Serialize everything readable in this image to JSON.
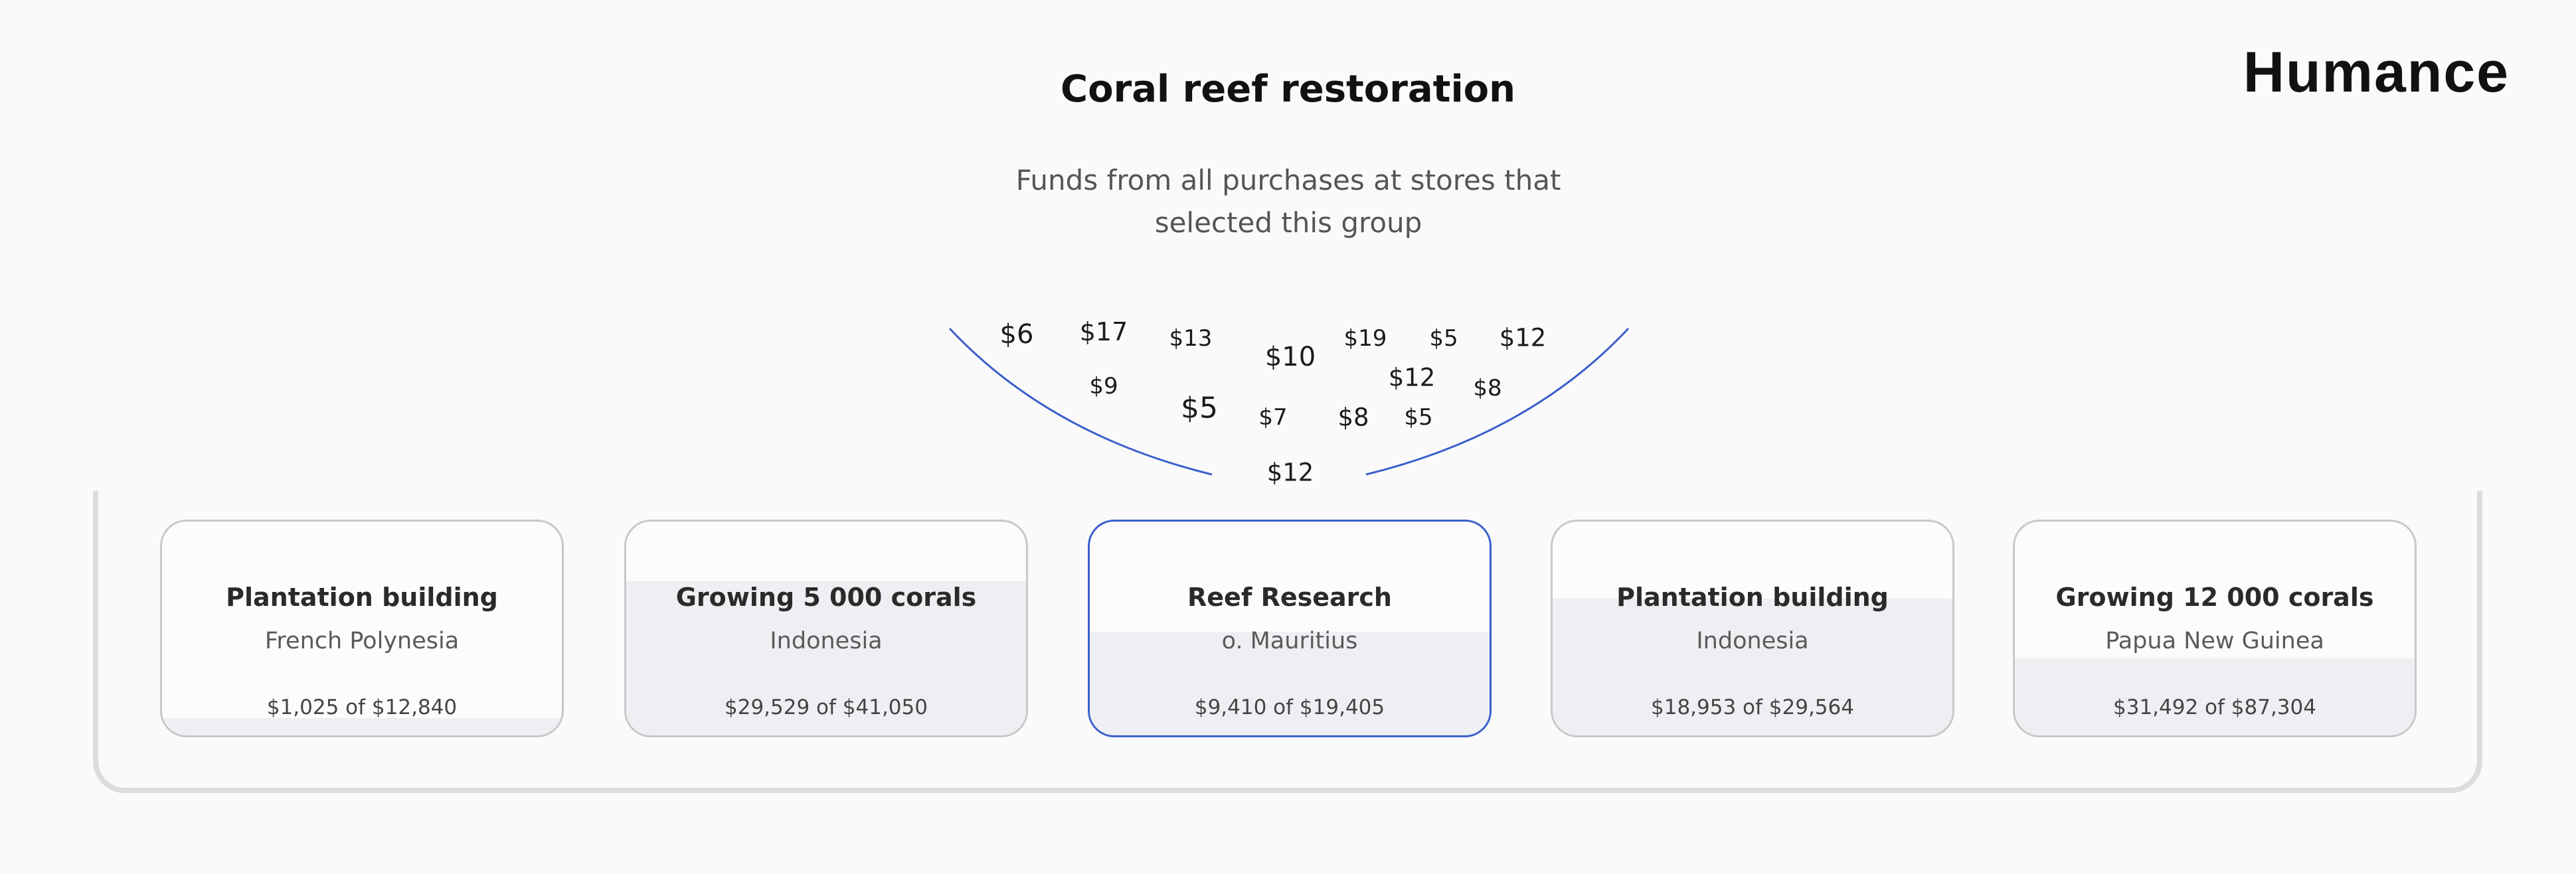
{
  "brand": "Humance",
  "header": {
    "title": "Coral reef restoration",
    "subtitle": "Funds from all purchases at stores that selected this group"
  },
  "amounts": [
    "$6",
    "$17",
    "$13",
    "$10",
    "$19",
    "$5",
    "$12",
    "$9",
    "$5",
    "$12",
    "$8",
    "$7",
    "$8",
    "$5",
    "$12"
  ],
  "projects": [
    {
      "title": "Plantation building",
      "location": "French Polynesia",
      "raised": "$1,025",
      "goal": "$12,840",
      "progress_text": "$1,025 of $12,840",
      "fraction": 0.08,
      "selected": false
    },
    {
      "title": "Growing 5 000 corals",
      "location": "Indonesia",
      "raised": "$29,529",
      "goal": "$41,050",
      "progress_text": "$29,529 of $41,050",
      "fraction": 0.72,
      "selected": false
    },
    {
      "title": "Reef Research",
      "location": "o. Mauritius",
      "raised": "$9,410",
      "goal": "$19,405",
      "progress_text": "$9,410 of $19,405",
      "fraction": 0.485,
      "selected": true
    },
    {
      "title": "Plantation building",
      "location": "Indonesia",
      "raised": "$18,953",
      "goal": "$29,564",
      "progress_text": "$18,953 of $29,564",
      "fraction": 0.64,
      "selected": false
    },
    {
      "title": "Growing 12 000 corals",
      "location": "Papua New Guinea",
      "raised": "$31,492",
      "goal": "$87,304",
      "progress_text": "$31,492 of $87,304",
      "fraction": 0.36,
      "selected": false
    }
  ],
  "colors": {
    "accent": "#3a5fcd",
    "card_fill": "#eeeff2",
    "frame": "#dcdcdc"
  }
}
